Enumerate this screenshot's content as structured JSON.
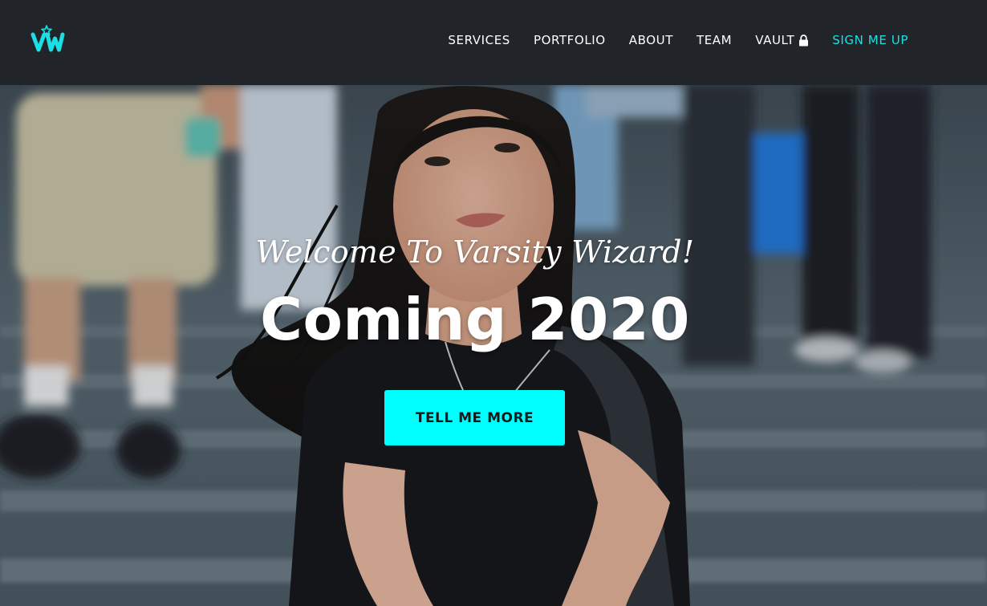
{
  "brand": {
    "logo_text": "VW",
    "logo_color": "#19e0e6",
    "star_icon": "star-icon"
  },
  "nav": {
    "items": [
      {
        "label": "SERVICES"
      },
      {
        "label": "PORTFOLIO"
      },
      {
        "label": "ABOUT"
      },
      {
        "label": "TEAM"
      },
      {
        "label": "VAULT",
        "icon": "lock-icon"
      },
      {
        "label": "SIGN ME UP",
        "accent": true
      }
    ],
    "background": "#212529",
    "accent_color": "#19e0e6"
  },
  "hero": {
    "subtitle": "Welcome To Varsity Wizard!",
    "title": "Coming 2020",
    "cta_label": "TELL ME MORE",
    "cta_color": "#00ffff"
  }
}
